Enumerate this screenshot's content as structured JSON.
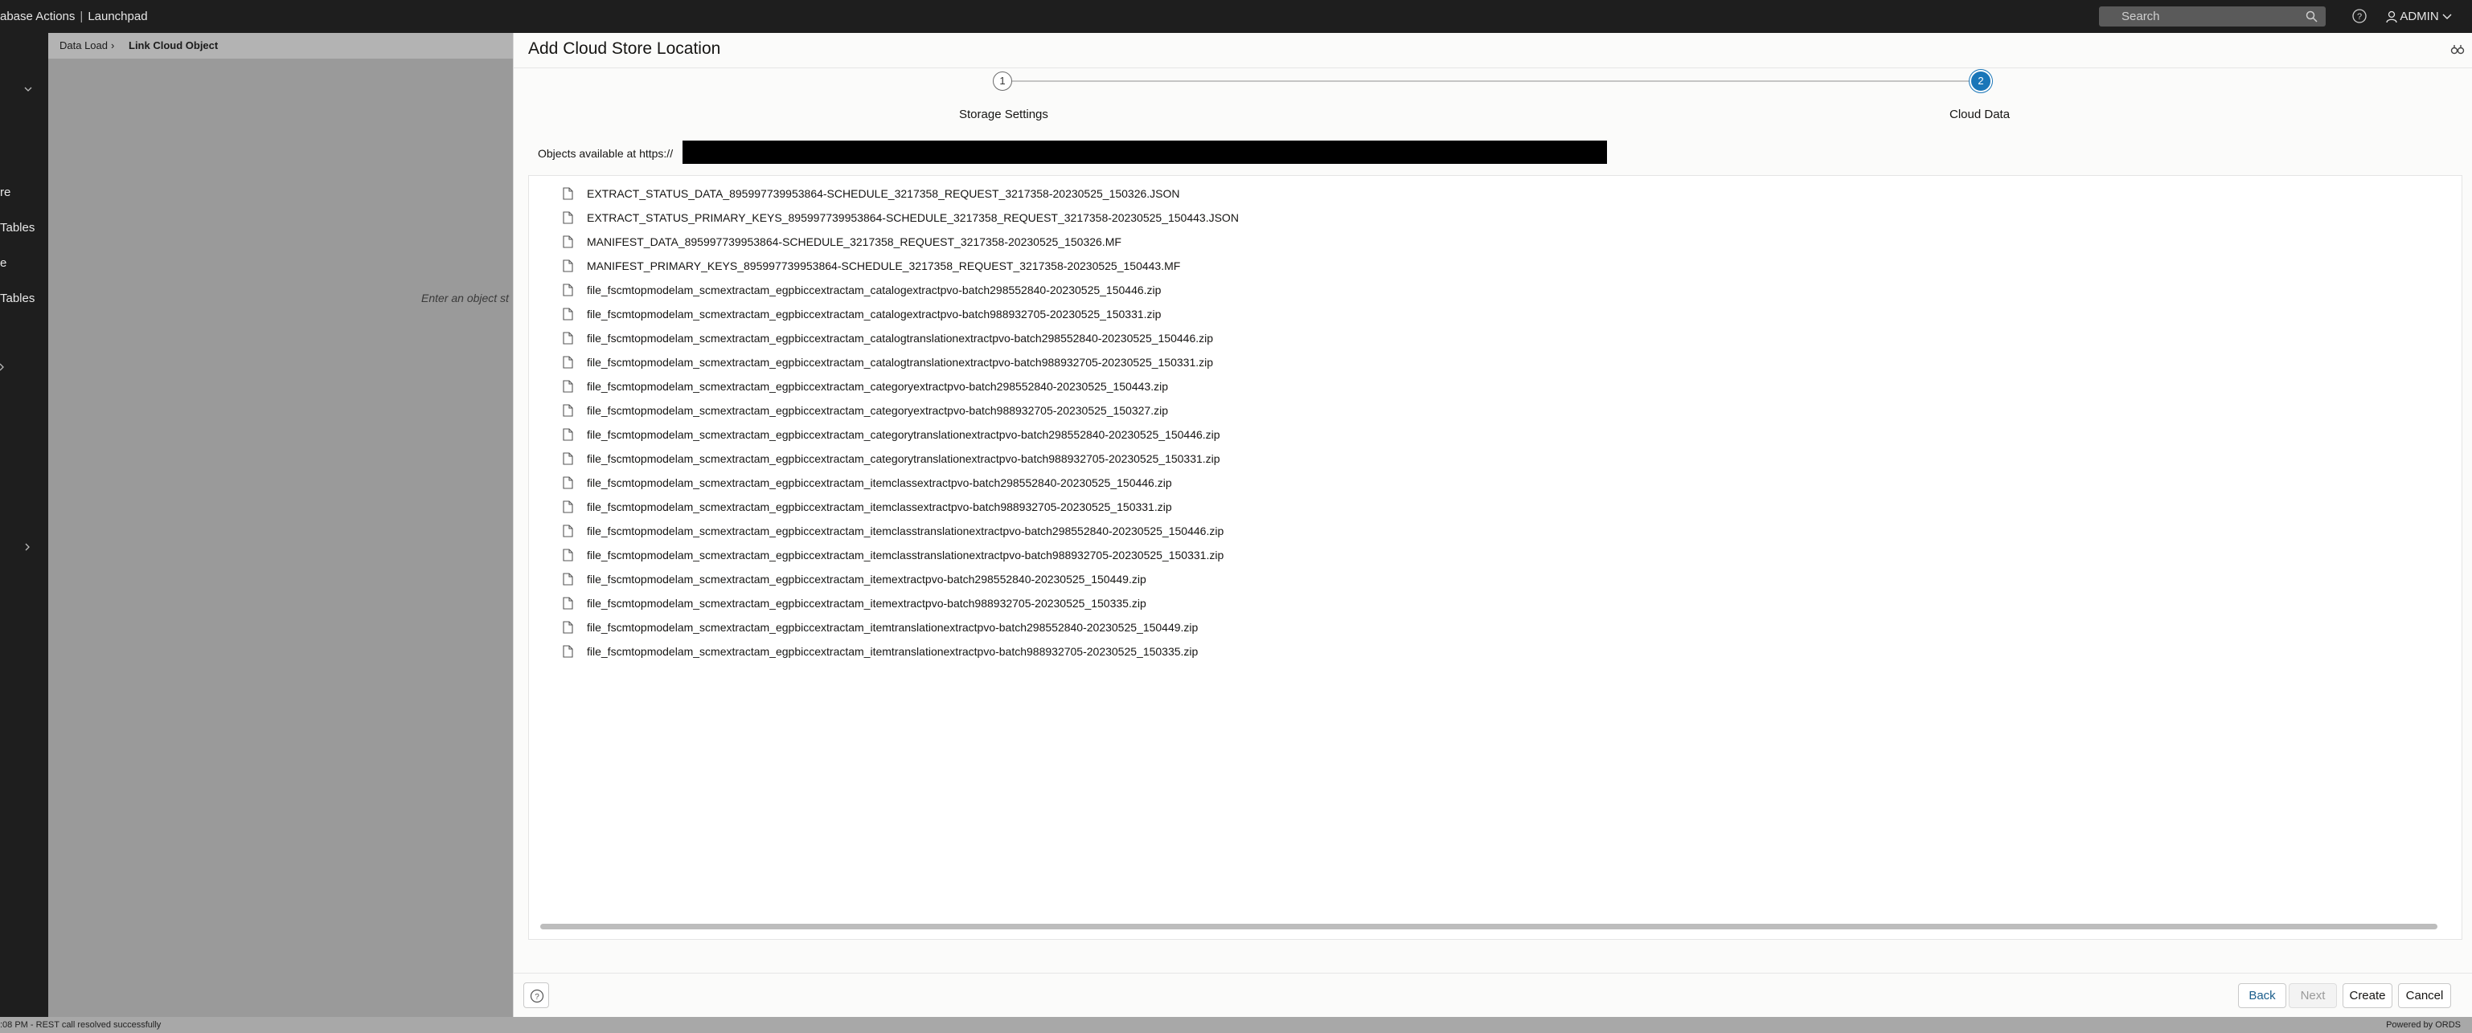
{
  "topbar": {
    "app_title": "Database Actions",
    "app_title_visible": "abase Actions",
    "launchpad": "Launchpad",
    "search_placeholder": "Search",
    "user": "ADMIN"
  },
  "leftnav": {
    "items": [
      "re",
      "Tables",
      "e",
      "Tables"
    ]
  },
  "breadcrumb": {
    "parent": "Data Load",
    "current": "Link Cloud Object"
  },
  "page": {
    "hint": "Enter an object st"
  },
  "statusbar": {
    "left": ":08 PM - REST call resolved successfully",
    "right": "Powered by ORDS"
  },
  "dialog": {
    "title": "Add Cloud Store Location",
    "steps": [
      {
        "number": "1",
        "label": "Storage Settings"
      },
      {
        "number": "2",
        "label": "Cloud Data"
      }
    ],
    "objects_label": "Objects available at https://",
    "files": [
      "EXTRACT_STATUS_DATA_895997739953864-SCHEDULE_3217358_REQUEST_3217358-20230525_150326.JSON",
      "EXTRACT_STATUS_PRIMARY_KEYS_895997739953864-SCHEDULE_3217358_REQUEST_3217358-20230525_150443.JSON",
      "MANIFEST_DATA_895997739953864-SCHEDULE_3217358_REQUEST_3217358-20230525_150326.MF",
      "MANIFEST_PRIMARY_KEYS_895997739953864-SCHEDULE_3217358_REQUEST_3217358-20230525_150443.MF",
      "file_fscmtopmodelam_scmextractam_egpbiccextractam_catalogextractpvo-batch298552840-20230525_150446.zip",
      "file_fscmtopmodelam_scmextractam_egpbiccextractam_catalogextractpvo-batch988932705-20230525_150331.zip",
      "file_fscmtopmodelam_scmextractam_egpbiccextractam_catalogtranslationextractpvo-batch298552840-20230525_150446.zip",
      "file_fscmtopmodelam_scmextractam_egpbiccextractam_catalogtranslationextractpvo-batch988932705-20230525_150331.zip",
      "file_fscmtopmodelam_scmextractam_egpbiccextractam_categoryextractpvo-batch298552840-20230525_150443.zip",
      "file_fscmtopmodelam_scmextractam_egpbiccextractam_categoryextractpvo-batch988932705-20230525_150327.zip",
      "file_fscmtopmodelam_scmextractam_egpbiccextractam_categorytranslationextractpvo-batch298552840-20230525_150446.zip",
      "file_fscmtopmodelam_scmextractam_egpbiccextractam_categorytranslationextractpvo-batch988932705-20230525_150331.zip",
      "file_fscmtopmodelam_scmextractam_egpbiccextractam_itemclassextractpvo-batch298552840-20230525_150446.zip",
      "file_fscmtopmodelam_scmextractam_egpbiccextractam_itemclassextractpvo-batch988932705-20230525_150331.zip",
      "file_fscmtopmodelam_scmextractam_egpbiccextractam_itemclasstranslationextractpvo-batch298552840-20230525_150446.zip",
      "file_fscmtopmodelam_scmextractam_egpbiccextractam_itemclasstranslationextractpvo-batch988932705-20230525_150331.zip",
      "file_fscmtopmodelam_scmextractam_egpbiccextractam_itemextractpvo-batch298552840-20230525_150449.zip",
      "file_fscmtopmodelam_scmextractam_egpbiccextractam_itemextractpvo-batch988932705-20230525_150335.zip",
      "file_fscmtopmodelam_scmextractam_egpbiccextractam_itemtranslationextractpvo-batch298552840-20230525_150449.zip",
      "file_fscmtopmodelam_scmextractam_egpbiccextractam_itemtranslationextractpvo-batch988932705-20230525_150335.zip"
    ],
    "buttons": {
      "back": "Back",
      "next": "Next",
      "create": "Create",
      "cancel": "Cancel"
    }
  },
  "colors": {
    "accent": "#1a76b8",
    "topbar": "#1e1e1e",
    "overlay": "#9a9a9a"
  }
}
